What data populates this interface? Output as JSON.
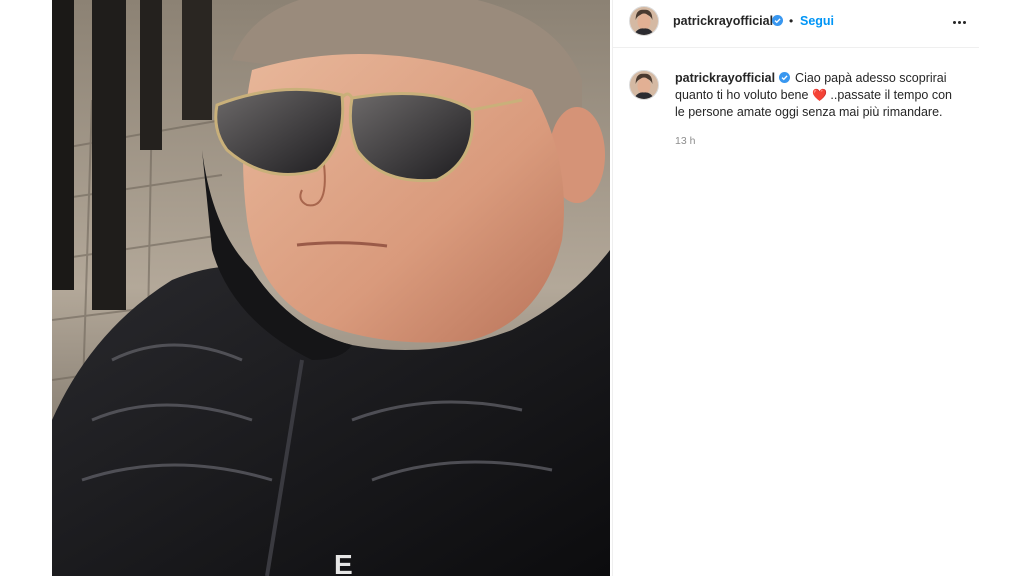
{
  "post": {
    "image_alt": "Foto di un uomo anziano con occhiali da sole a goccia e piumino nero"
  },
  "header": {
    "username": "patrickrayofficial",
    "verified_icon": "verified-badge-icon",
    "separator": "•",
    "follow_label": "Segui",
    "more_icon": "more-options-icon"
  },
  "caption": {
    "username": "patrickrayofficial",
    "text_before_emoji": "Ciao papà adesso scoprirai quanto ti ho voluto bene",
    "emoji": "❤️",
    "text_after_emoji": "..passate il tempo con le persone amate oggi senza mai più rimandare.",
    "timestamp": "13 h"
  },
  "colors": {
    "link_blue": "#0095f6",
    "verified_blue": "#3897f0",
    "heart_red": "#ed4956",
    "muted": "#8e8e8e"
  }
}
